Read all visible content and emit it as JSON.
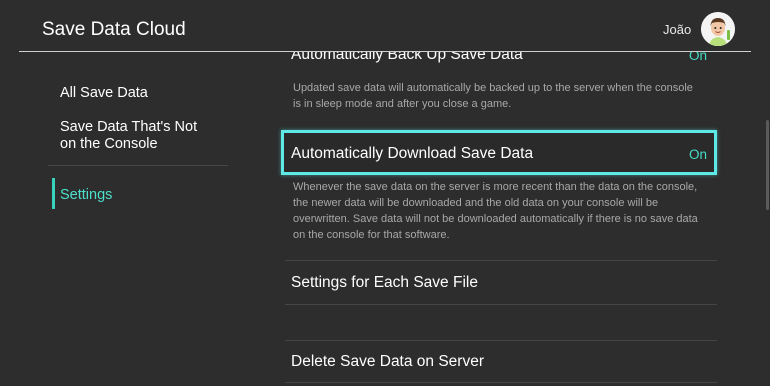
{
  "header": {
    "title": "Save Data Cloud",
    "user_name": "João"
  },
  "sidebar": {
    "items": [
      {
        "label": "All Save Data"
      },
      {
        "label": "Save Data That's Not\non the Console"
      },
      {
        "label": "Settings"
      }
    ]
  },
  "settings": {
    "rows": [
      {
        "title": "Automatically Back Up Save Data",
        "value": "On",
        "description": "Updated save data will automatically be backed up to the server when the console is in sleep mode and after you close a game."
      },
      {
        "title": "Automatically Download Save Data",
        "value": "On",
        "description": "Whenever the save data on the server is more recent than the data on the console, the newer data will be downloaded and the old data on your console will be overwritten. Save data will not be downloaded automatically if there is no save data on the console for that software."
      },
      {
        "title": "Settings for Each Save File"
      },
      {
        "title": "Delete Save Data on Server"
      }
    ]
  },
  "colors": {
    "background": "#2d2d2d",
    "accent": "#44dcc6",
    "selection_border": "#5fe9e6"
  }
}
